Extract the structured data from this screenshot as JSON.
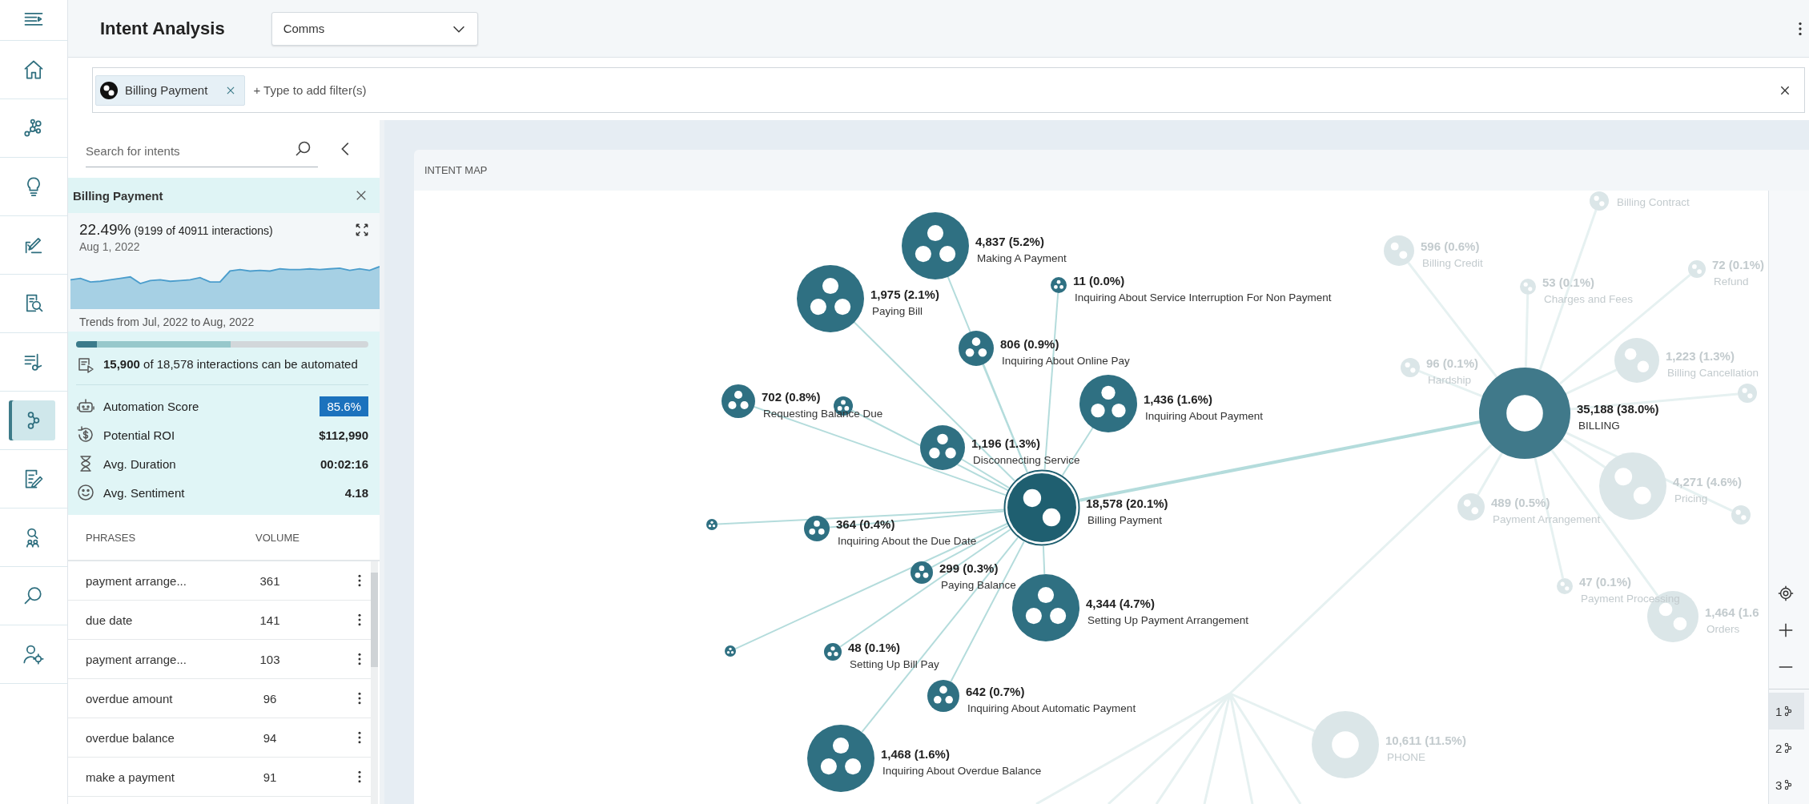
{
  "header": {
    "title": "Intent Analysis",
    "dropdown": {
      "value": "Comms"
    }
  },
  "sidebar": {
    "items": [
      {
        "selected": false
      },
      {
        "selected": false
      },
      {
        "selected": false
      },
      {
        "selected": false
      },
      {
        "selected": false
      },
      {
        "selected": false
      },
      {
        "selected": true
      },
      {
        "selected": false
      },
      {
        "selected": false
      },
      {
        "selected": false
      },
      {
        "selected": false
      }
    ]
  },
  "filter_bar": {
    "chips": [
      {
        "label": "Billing Payment"
      }
    ],
    "placeholder": "+ Type to add filter(s)"
  },
  "intent_panel": {
    "search": {
      "placeholder": "Search for intents"
    },
    "detail": {
      "title": "Billing Payment",
      "share": "22.49%",
      "share_detail": "(9199 of 40911 interactions)",
      "date": "Aug 1, 2022",
      "trend_caption": "Trends from Jul, 2022 to Aug, 2022",
      "automation_bar": [
        {
          "level": 0.07
        },
        {
          "level": 0.53
        }
      ],
      "automation_text": "**15,900** of 18,578 interactions can be automated",
      "metrics": [
        {
          "label": "Automation Score",
          "value": "85.6%",
          "kind": "badge"
        },
        {
          "label": "Potential ROI",
          "value": "$112,990",
          "kind": "plain"
        },
        {
          "label": "Avg. Duration",
          "value": "00:02:16",
          "kind": "plain"
        },
        {
          "label": "Avg. Sentiment",
          "value": "4.18",
          "kind": "plain"
        }
      ]
    },
    "phrases": {
      "columns": [
        "PHRASES",
        "VOLUME"
      ],
      "rows": [
        {
          "phrase": "payment arrange...",
          "volume": "361"
        },
        {
          "phrase": "due date",
          "volume": "141"
        },
        {
          "phrase": "payment arrange...",
          "volume": "103"
        },
        {
          "phrase": "overdue amount",
          "volume": "96"
        },
        {
          "phrase": "overdue balance",
          "volume": "94"
        },
        {
          "phrase": "make a payment",
          "volume": "91"
        }
      ]
    }
  },
  "intent_map": {
    "title": "INTENT MAP",
    "nodes": [
      {
        "kind": "intent",
        "value": "4,837 (5.2%)",
        "label": "Making A Payment",
        "selected": false,
        "dimmed": false
      },
      {
        "kind": "intent",
        "value": "1,975 (2.1%)",
        "label": "Paying Bill",
        "selected": false,
        "dimmed": false
      },
      {
        "kind": "intent",
        "value": "11 (0.0%)",
        "label": "Inquiring About Service Interruption For Non Payment",
        "selected": false,
        "dimmed": false
      },
      {
        "kind": "intent",
        "value": "806 (0.9%)",
        "label": "Inquiring About Online Pay",
        "selected": false,
        "dimmed": false
      },
      {
        "kind": "intent",
        "value": "702 (0.8%)",
        "label": "Requesting Balance Due",
        "selected": false,
        "dimmed": false
      },
      {
        "kind": "intent",
        "value": "1,436 (1.6%)",
        "label": "Inquiring About Payment",
        "selected": false,
        "dimmed": false
      },
      {
        "kind": "intent",
        "value": "1,196 (1.3%)",
        "label": "Disconnecting Service",
        "selected": false,
        "dimmed": false
      },
      {
        "kind": "intent",
        "value": "18,578 (20.1%)",
        "label": "Billing Payment",
        "selected": true,
        "dimmed": false
      },
      {
        "kind": "intent",
        "value": "364 (0.4%)",
        "label": "Inquiring About the Due Date",
        "selected": false,
        "dimmed": false
      },
      {
        "kind": "intent",
        "value": "299 (0.3%)",
        "label": "Paying Balance",
        "selected": false,
        "dimmed": false
      },
      {
        "kind": "intent",
        "value": "4,344 (4.7%)",
        "label": "Setting Up Payment Arrangement",
        "selected": false,
        "dimmed": false
      },
      {
        "kind": "intent",
        "value": "48 (0.1%)",
        "label": "Setting Up Bill Pay",
        "selected": false,
        "dimmed": false
      },
      {
        "kind": "intent",
        "value": "642 (0.7%)",
        "label": "Inquiring About Automatic Payment",
        "selected": false,
        "dimmed": false
      },
      {
        "kind": "intent",
        "value": "1,468 (1.6%)",
        "label": "Inquiring About Overdue Balance",
        "selected": false,
        "dimmed": false
      },
      {
        "kind": "topic",
        "value": "35,188 (38.0%)",
        "label": "BILLING",
        "selected": false,
        "dimmed": false
      },
      {
        "kind": "intent",
        "label": "Billing Contract",
        "selected": false,
        "dimmed": true
      },
      {
        "kind": "intent",
        "value": "596 (0.6%)",
        "label": "Billing Credit",
        "selected": false,
        "dimmed": true
      },
      {
        "kind": "intent",
        "value": "53 (0.1%)",
        "label": "Charges and Fees",
        "selected": false,
        "dimmed": true
      },
      {
        "kind": "intent",
        "value": "72 (0.1%)",
        "label": "Refund",
        "selected": false,
        "dimmed": true
      },
      {
        "kind": "intent",
        "value": "96 (0.1%)",
        "label": "Hardship",
        "selected": false,
        "dimmed": true
      },
      {
        "kind": "intent",
        "value": "1,223 (1.3%)",
        "label": "Billing Cancellation",
        "selected": false,
        "dimmed": true
      },
      {
        "kind": "intent",
        "value": "4,271 (4.6%)",
        "label": "Pricing",
        "selected": false,
        "dimmed": true
      },
      {
        "kind": "intent",
        "value": "489 (0.5%)",
        "label": "Payment Arrangement",
        "selected": false,
        "dimmed": true
      },
      {
        "kind": "intent",
        "value": "47 (0.1%)",
        "label": "Payment Processing",
        "selected": false,
        "dimmed": true
      },
      {
        "kind": "intent",
        "value": "1,464 (1.6",
        "label": "Orders",
        "selected": false,
        "dimmed": true
      },
      {
        "kind": "topic",
        "value": "10,611 (11.5%)",
        "label": "PHONE",
        "selected": false,
        "dimmed": true
      }
    ],
    "levels": [
      {
        "label": "1",
        "selected": true
      },
      {
        "label": "2",
        "selected": false
      },
      {
        "label": "3",
        "selected": false
      }
    ]
  }
}
